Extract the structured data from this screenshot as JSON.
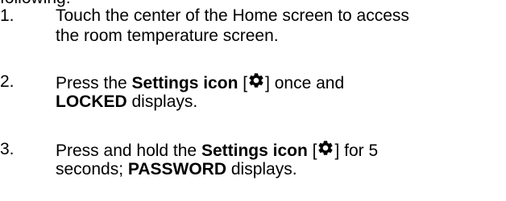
{
  "document": {
    "intro_fragment": "following:",
    "steps": [
      {
        "number": "1.",
        "line1": "Touch the center of the Home screen to access",
        "line2": "the room temperature screen."
      },
      {
        "number": "2.",
        "pre": "Press the ",
        "bold1": "Settings icon",
        "bracket_open": " [",
        "bracket_close": "] once and",
        "bold2": "LOCKED",
        "post2": " displays."
      },
      {
        "number": "3.",
        "pre": "Press and hold the ",
        "bold1": "Settings icon",
        "bracket_open": " [",
        "bracket_close": "] for 5",
        "pre2": "seconds; ",
        "bold2": "PASSWORD",
        "post2": " displays."
      }
    ]
  },
  "icons": {
    "settings": "gear-icon"
  }
}
